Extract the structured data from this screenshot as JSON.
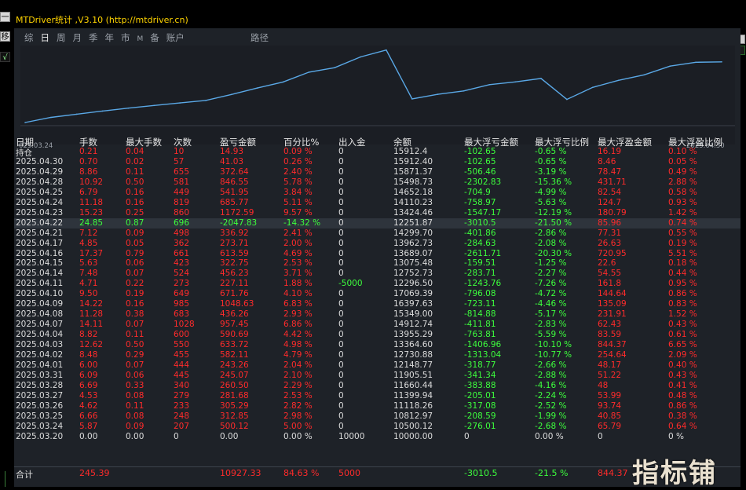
{
  "window": {
    "title": "MTDriver统计 ,V3.10 (http://mtdriver.cn)"
  },
  "leftbar": {
    "btn1": "一",
    "btn2": "移",
    "btn3": "√"
  },
  "tabs": [
    "综",
    "日",
    "周",
    "月",
    "季",
    "年",
    "市",
    "M",
    "备",
    "账户"
  ],
  "active_tab": "日",
  "path_label": "路径",
  "chart_data": {
    "type": "line",
    "x_start_label": "025.03.24",
    "x_end_label": "2025.04.30",
    "x": [
      "2025.03.20",
      "2025.03.24",
      "2025.03.25",
      "2025.03.26",
      "2025.03.27",
      "2025.03.28",
      "2025.03.31",
      "2025.04.01",
      "2025.04.02",
      "2025.04.03",
      "2025.04.04",
      "2025.04.07",
      "2025.04.08",
      "2025.04.09",
      "2025.04.10",
      "2025.04.11",
      "2025.04.14",
      "2025.04.15",
      "2025.04.16",
      "2025.04.17",
      "2025.04.21",
      "2025.04.22",
      "2025.04.23",
      "2025.04.24",
      "2025.04.25",
      "2025.04.28",
      "2025.04.29",
      "2025.04.30"
    ],
    "values": [
      10000.0,
      10500.12,
      10812.97,
      11118.26,
      11399.94,
      11660.44,
      11905.51,
      12148.77,
      12730.88,
      13364.6,
      13955.29,
      14912.74,
      15349.0,
      16397.63,
      17069.39,
      12296.5,
      12752.73,
      13075.48,
      13689.07,
      13962.73,
      14299.7,
      12251.87,
      13424.46,
      14110.23,
      14652.18,
      15498.73,
      15871.37,
      15912.4
    ],
    "series_color": "#5aa8e6"
  },
  "table": {
    "headers": [
      "日期",
      "手数",
      "最大手数",
      "次数",
      "盈亏金额",
      "百分比%",
      "出入金",
      "余额",
      "最大浮亏金额",
      "最大浮亏比例",
      "最大浮盈金额",
      "最大浮盈比例"
    ],
    "rows": [
      [
        "持仓",
        "0.21",
        "0.04",
        "10",
        "14.93",
        "0.09 %",
        "0",
        "15912.4",
        "-102.65",
        "-0.65 %",
        "16.19",
        "0.10 %"
      ],
      [
        "2025.04.30",
        "0.70",
        "0.02",
        "57",
        "41.03",
        "0.26 %",
        "0",
        "15912.40",
        "-102.65",
        "-0.65 %",
        "8.46",
        "0.05 %"
      ],
      [
        "2025.04.29",
        "8.86",
        "0.11",
        "655",
        "372.64",
        "2.40 %",
        "0",
        "15871.37",
        "-506.46",
        "-3.19 %",
        "78.47",
        "0.49 %"
      ],
      [
        "2025.04.28",
        "10.92",
        "0.50",
        "581",
        "846.55",
        "5.78 %",
        "0",
        "15498.73",
        "-2302.83",
        "-15.36 %",
        "431.71",
        "2.88 %"
      ],
      [
        "2025.04.25",
        "6.79",
        "0.16",
        "449",
        "541.95",
        "3.84 %",
        "0",
        "14652.18",
        "-704.9",
        "-4.99 %",
        "82.54",
        "0.58 %"
      ],
      [
        "2025.04.24",
        "11.18",
        "0.16",
        "819",
        "685.77",
        "5.11 %",
        "0",
        "14110.23",
        "-758.97",
        "-5.63 %",
        "124.7",
        "0.93 %"
      ],
      [
        "2025.04.23",
        "15.23",
        "0.25",
        "860",
        "1172.59",
        "9.57 %",
        "0",
        "13424.46",
        "-1547.17",
        "-12.19 %",
        "180.79",
        "1.42 %"
      ],
      [
        "2025.04.22",
        "24.85",
        "0.87",
        "696",
        "-2047.83",
        "-14.32 %",
        "0",
        "12251.87",
        "-3010.5",
        "-21.50 %",
        "85.96",
        "0.74 %"
      ],
      [
        "2025.04.21",
        "7.12",
        "0.09",
        "498",
        "336.92",
        "2.41 %",
        "0",
        "14299.70",
        "-401.86",
        "-2.86 %",
        "77.31",
        "0.55 %"
      ],
      [
        "2025.04.17",
        "4.85",
        "0.05",
        "362",
        "273.71",
        "2.00 %",
        "0",
        "13962.73",
        "-284.63",
        "-2.08 %",
        "26.63",
        "0.19 %"
      ],
      [
        "2025.04.16",
        "17.37",
        "0.79",
        "661",
        "613.59",
        "4.69 %",
        "0",
        "13689.07",
        "-2611.71",
        "-20.30 %",
        "720.95",
        "5.51 %"
      ],
      [
        "2025.04.15",
        "5.63",
        "0.06",
        "423",
        "322.75",
        "2.53 %",
        "0",
        "13075.48",
        "-159.51",
        "-1.25 %",
        "22.6",
        "0.18 %"
      ],
      [
        "2025.04.14",
        "7.48",
        "0.07",
        "524",
        "456.23",
        "3.71 %",
        "0",
        "12752.73",
        "-283.71",
        "-2.27 %",
        "54.55",
        "0.44 %"
      ],
      [
        "2025.04.11",
        "4.71",
        "0.22",
        "273",
        "227.11",
        "1.88 %",
        "-5000",
        "12296.50",
        "-1243.76",
        "-7.26 %",
        "161.8",
        "0.95 %"
      ],
      [
        "2025.04.10",
        "9.50",
        "0.19",
        "649",
        "671.76",
        "4.10 %",
        "0",
        "17069.39",
        "-796.08",
        "-4.72 %",
        "144.64",
        "0.86 %"
      ],
      [
        "2025.04.09",
        "14.22",
        "0.16",
        "985",
        "1048.63",
        "6.83 %",
        "0",
        "16397.63",
        "-723.11",
        "-4.46 %",
        "135.09",
        "0.83 %"
      ],
      [
        "2025.04.08",
        "11.28",
        "0.38",
        "683",
        "436.26",
        "2.93 %",
        "0",
        "15349.00",
        "-814.88",
        "-5.17 %",
        "231.91",
        "1.52 %"
      ],
      [
        "2025.04.07",
        "14.11",
        "0.07",
        "1028",
        "957.45",
        "6.86 %",
        "0",
        "14912.74",
        "-411.81",
        "-2.83 %",
        "62.43",
        "0.43 %"
      ],
      [
        "2025.04.04",
        "8.82",
        "0.11",
        "600",
        "590.69",
        "4.42 %",
        "0",
        "13955.29",
        "-763.81",
        "-5.59 %",
        "83.59",
        "0.61 %"
      ],
      [
        "2025.04.03",
        "12.62",
        "0.50",
        "550",
        "633.72",
        "4.98 %",
        "0",
        "13364.60",
        "-1406.96",
        "-10.10 %",
        "844.37",
        "6.65 %"
      ],
      [
        "2025.04.02",
        "8.48",
        "0.29",
        "455",
        "582.11",
        "4.79 %",
        "0",
        "12730.88",
        "-1313.04",
        "-10.77 %",
        "254.64",
        "2.09 %"
      ],
      [
        "2025.04.01",
        "6.00",
        "0.07",
        "444",
        "243.26",
        "2.04 %",
        "0",
        "12148.77",
        "-318.77",
        "-2.66 %",
        "48.17",
        "0.40 %"
      ],
      [
        "2025.03.31",
        "6.09",
        "0.06",
        "445",
        "245.07",
        "2.10 %",
        "0",
        "11905.51",
        "-341.34",
        "-2.88 %",
        "51.22",
        "0.43 %"
      ],
      [
        "2025.03.28",
        "6.69",
        "0.33",
        "340",
        "260.50",
        "2.29 %",
        "0",
        "11660.44",
        "-383.88",
        "-4.16 %",
        "48",
        "0.41 %"
      ],
      [
        "2025.03.27",
        "4.53",
        "0.08",
        "279",
        "281.68",
        "2.53 %",
        "0",
        "11399.94",
        "-205.01",
        "-2.24 %",
        "53.99",
        "0.48 %"
      ],
      [
        "2025.03.26",
        "4.62",
        "0.11",
        "233",
        "305.29",
        "2.82 %",
        "0",
        "11118.26",
        "-317.08",
        "-2.52 %",
        "93.74",
        "0.86 %"
      ],
      [
        "2025.03.25",
        "6.66",
        "0.08",
        "248",
        "312.85",
        "2.98 %",
        "0",
        "10812.97",
        "-208.59",
        "-1.99 %",
        "40.85",
        "0.38 %"
      ],
      [
        "2025.03.24",
        "5.87",
        "0.09",
        "207",
        "500.12",
        "5.00 %",
        "0",
        "10500.12",
        "-276.01",
        "-2.68 %",
        "65.79",
        "0.64 %"
      ],
      [
        "2025.03.20",
        "0.00",
        "0.00",
        "0",
        "0.00",
        "0.00 %",
        "10000",
        "10000.00",
        "0",
        "0.00 %",
        "0",
        "0 %"
      ]
    ],
    "total": [
      "合计",
      "245.39",
      "",
      "",
      "10927.33",
      "84.63 %",
      "5000",
      "",
      "-3010.5",
      "-21.5 %",
      "844.37",
      ""
    ]
  },
  "highlight_row_index": 7,
  "colors": {
    "profit": "#ff2b2b",
    "loss": "#3dff3d",
    "neutral": "#dcdcdc",
    "title": "#ffd400",
    "panel": "#1e2228"
  },
  "watermark": "指标铺"
}
